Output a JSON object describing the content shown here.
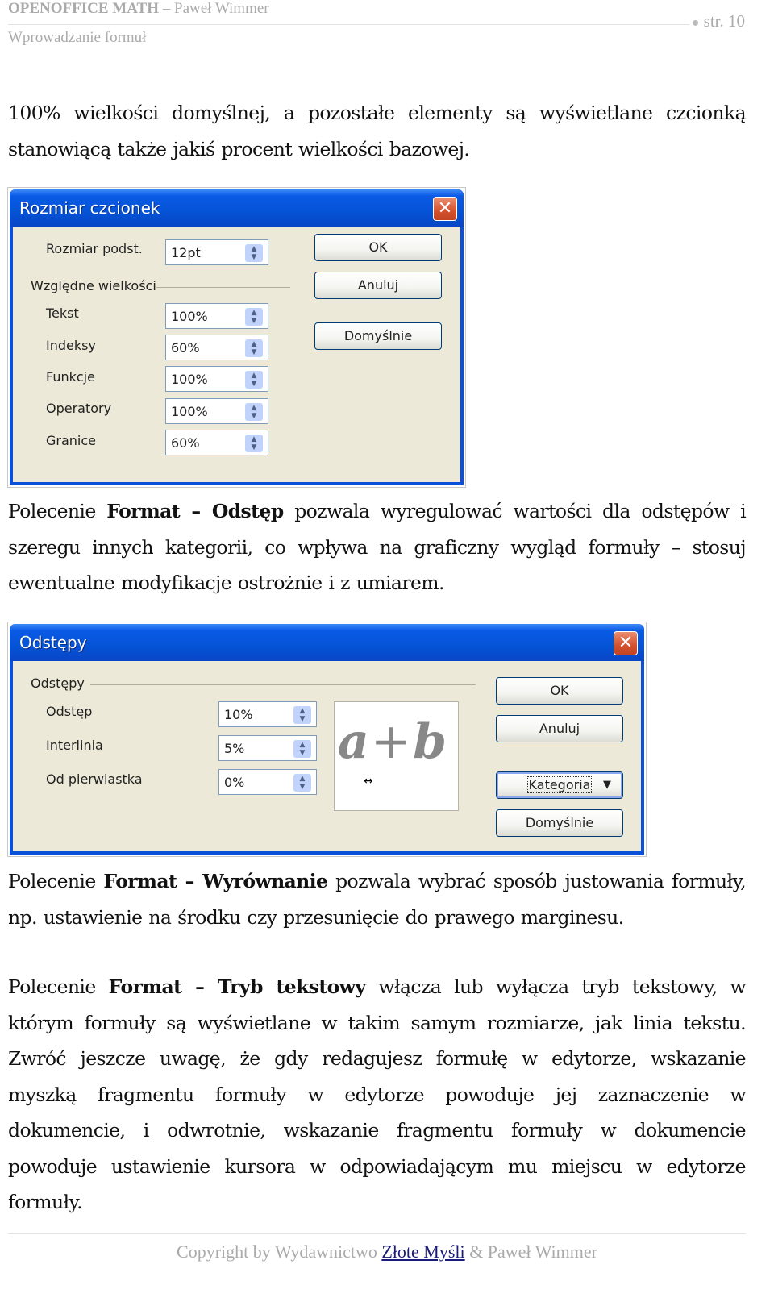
{
  "header": {
    "title_bold": "OPENOFFICE MATH",
    "title_rest": " – Paweł Wimmer",
    "subtitle": "Wprowadzanie formuł",
    "page_bullet": "●",
    "page": "str. 10"
  },
  "paragraphs": {
    "p1": "100% wielkości domyślnej, a pozostałe elementy są wyświetlane czcionką stanowiącą także jakiś procent wielkości bazowej.",
    "p2_a": "Polecenie ",
    "p2_b": "Format – Odstęp",
    "p2_c": " pozwala wyregulować wartości dla odstępów i szeregu innych kategorii, co wpływa na graficzny wygląd formuły – stosuj ewentualne modyfikacje ostrożnie i z umiarem.",
    "p3_a": "Polecenie ",
    "p3_b": "Format – Wyrównanie",
    "p3_c": " pozwala wybrać sposób justowania formuły, np. ustawienie na środku czy przesunięcie do prawego marginesu.",
    "p4_a": "Polecenie ",
    "p4_b": "Format – Tryb tekstowy",
    "p4_c": " włącza lub wyłącza tryb tekstowy, w którym formuły są wyświetlane w takim samym rozmiarze, jak linia tekstu. Zwróć jeszcze uwagę, że gdy redagujesz formułę w edytorze, wskazanie myszką fragmentu formuły w edytorze powoduje jej zaznaczenie w dokumencie, i odwrotnie, wskazanie fragmentu formuły w dokumencie powoduje ustawienie kursora w odpowiadającym mu miejscu w edytorze formuły."
  },
  "dialog1": {
    "title": "Rozmiar czcionek",
    "close": "✕",
    "base_label": "Rozmiar podst.",
    "base_value": "12pt",
    "group_label": "Względne wielkości",
    "rows": [
      {
        "label": "Tekst",
        "value": "100%"
      },
      {
        "label": "Indeksy",
        "value": "60%"
      },
      {
        "label": "Funkcje",
        "value": "100%"
      },
      {
        "label": "Operatory",
        "value": "100%"
      },
      {
        "label": "Granice",
        "value": "60%"
      }
    ],
    "ok": "OK",
    "cancel": "Anuluj",
    "default": "Domyślnie"
  },
  "dialog2": {
    "title": "Odstępy",
    "close": "✕",
    "group_label": "Odstępy",
    "rows": [
      {
        "label": "Odstęp",
        "value": "10%"
      },
      {
        "label": "Interlinia",
        "value": "5%"
      },
      {
        "label": "Od pierwiastka",
        "value": "0%"
      }
    ],
    "preview_a": "a",
    "preview_plus": "+",
    "preview_b": "b",
    "preview_measure": "↔",
    "ok": "OK",
    "cancel": "Anuluj",
    "category": "Kategoria",
    "category_arrow": "▼",
    "default": "Domyślnie"
  },
  "spin_arrows": "▲\n▼",
  "footer": {
    "pre": "Copyright by Wydawnictwo ",
    "link": "Złote Myśli",
    "post": " & Paweł Wimmer"
  }
}
